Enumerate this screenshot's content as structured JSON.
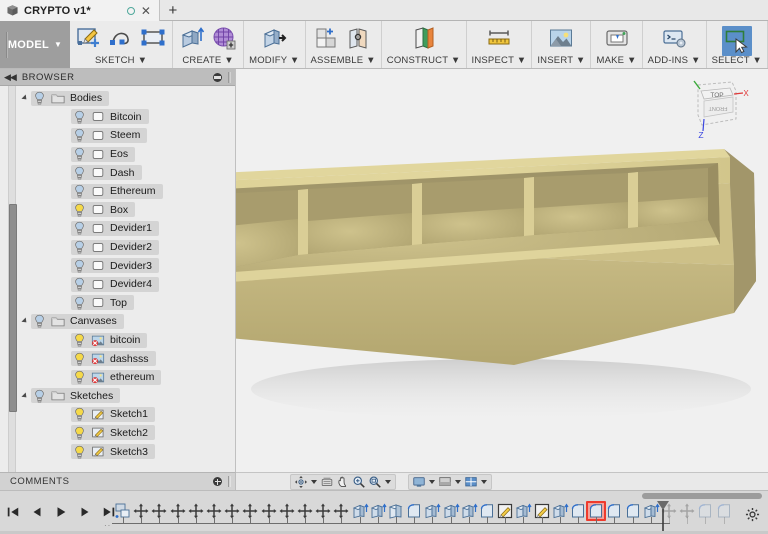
{
  "window": {
    "tab": {
      "title": "CRYPTO v1*",
      "doc_icon": "box-icon",
      "unsaved_dot": "unsaved-indicator",
      "close_label": "✕",
      "new_tab_label": "+"
    }
  },
  "ribbon": {
    "workspace": {
      "label": "MODEL",
      "caret": "▼"
    },
    "panels": [
      {
        "name": "sketch",
        "label": "SKETCH ▼",
        "icons": [
          "create-sketch-icon",
          "spline-icon",
          "rectangle-icon"
        ]
      },
      {
        "name": "create",
        "label": "CREATE ▼",
        "icons": [
          "extrude-icon",
          "form-icon"
        ]
      },
      {
        "name": "modify",
        "label": "MODIFY ▼",
        "icons": [
          "press-pull-icon"
        ]
      },
      {
        "name": "assemble",
        "label": "ASSEMBLE ▼",
        "icons": [
          "new-component-icon",
          "joint-icon"
        ]
      },
      {
        "name": "construct",
        "label": "CONSTRUCT ▼",
        "icons": [
          "offset-plane-icon"
        ]
      },
      {
        "name": "inspect",
        "label": "INSPECT ▼",
        "icons": [
          "measure-icon"
        ]
      },
      {
        "name": "insert",
        "label": "INSERT ▼",
        "icons": [
          "insert-canvas-icon"
        ]
      },
      {
        "name": "make",
        "label": "MAKE ▼",
        "icons": [
          "3d-print-icon"
        ]
      },
      {
        "name": "addins",
        "label": "ADD-INS ▼",
        "icons": [
          "scripts-addins-icon"
        ]
      },
      {
        "name": "select",
        "label": "SELECT ▼",
        "icons": [
          "select-cursor-icon"
        ],
        "active": true
      }
    ]
  },
  "browser": {
    "header": {
      "title": "BROWSER",
      "collapse_icon": "collapse-left-icon",
      "options_icon": "panel-options-icon"
    },
    "tree": [
      {
        "label": "Bodies",
        "depth": 1,
        "icon": "folder-icon",
        "expanded": true,
        "bulb": "on-blue"
      },
      {
        "label": "Bitcoin",
        "depth": 2,
        "icon": "body-icon",
        "expanded": false,
        "bulb": "on-blue"
      },
      {
        "label": "Steem",
        "depth": 2,
        "icon": "body-icon",
        "expanded": false,
        "bulb": "on-blue"
      },
      {
        "label": "Eos",
        "depth": 2,
        "icon": "body-icon",
        "expanded": false,
        "bulb": "on-blue"
      },
      {
        "label": "Dash",
        "depth": 2,
        "icon": "body-icon",
        "expanded": false,
        "bulb": "on-blue"
      },
      {
        "label": "Ethereum",
        "depth": 2,
        "icon": "body-icon",
        "expanded": false,
        "bulb": "on-blue"
      },
      {
        "label": "Box",
        "depth": 2,
        "icon": "body-icon",
        "expanded": false,
        "bulb": "on-yellow"
      },
      {
        "label": "Devider1",
        "depth": 2,
        "icon": "body-icon",
        "expanded": false,
        "bulb": "on-blue"
      },
      {
        "label": "Devider2",
        "depth": 2,
        "icon": "body-icon",
        "expanded": false,
        "bulb": "on-blue"
      },
      {
        "label": "Devider3",
        "depth": 2,
        "icon": "body-icon",
        "expanded": false,
        "bulb": "on-blue"
      },
      {
        "label": "Devider4",
        "depth": 2,
        "icon": "body-icon",
        "expanded": false,
        "bulb": "on-blue"
      },
      {
        "label": "Top",
        "depth": 2,
        "icon": "body-icon",
        "expanded": false,
        "bulb": "on-blue"
      },
      {
        "label": "Canvases",
        "depth": 1,
        "icon": "folder-icon",
        "expanded": true,
        "bulb": "on-blue"
      },
      {
        "label": "bitcoin",
        "depth": 2,
        "icon": "canvas-icon",
        "expanded": false,
        "bulb": "on-yellow"
      },
      {
        "label": "dashsss",
        "depth": 2,
        "icon": "canvas-icon",
        "expanded": false,
        "bulb": "on-yellow"
      },
      {
        "label": "ethereum",
        "depth": 2,
        "icon": "canvas-icon",
        "expanded": false,
        "bulb": "on-yellow"
      },
      {
        "label": "Sketches",
        "depth": 1,
        "icon": "folder-icon",
        "expanded": true,
        "bulb": "on-blue"
      },
      {
        "label": "Sketch1",
        "depth": 2,
        "icon": "sketch-icon",
        "expanded": false,
        "bulb": "on-yellow"
      },
      {
        "label": "Sketch2",
        "depth": 2,
        "icon": "sketch-icon",
        "expanded": false,
        "bulb": "on-yellow"
      },
      {
        "label": "Sketch3",
        "depth": 2,
        "icon": "sketch-icon",
        "expanded": false,
        "bulb": "on-yellow"
      }
    ]
  },
  "comments": {
    "title": "COMMENTS",
    "add_icon": "add-comment-icon"
  },
  "viewport": {
    "background_color": "#f0f0f0",
    "model": {
      "name": "divided-tray",
      "compartments": 5,
      "face_color": "#c3b681",
      "rim_color": "#d9cd8f",
      "inner_color": "#a79b6b",
      "shadow_color": "#d8d8d8"
    },
    "viewcube": {
      "top_face_label": "TOP",
      "front_face_label": "FRONT",
      "axis_x_label": "X",
      "axis_x_color": "#e03a3a",
      "axis_z_label": "Z",
      "axis_z_color": "#3a46e0",
      "axis_y_color": "#3aaa3a"
    }
  },
  "navbar": {
    "group1": [
      {
        "name": "orbit-icon",
        "has_caret": true
      },
      {
        "name": "look-at-icon",
        "has_caret": false
      },
      {
        "name": "pan-icon",
        "has_caret": false
      },
      {
        "name": "zoom-icon",
        "has_caret": false
      },
      {
        "name": "zoom-window-icon",
        "has_caret": true
      }
    ],
    "group2": [
      {
        "name": "display-settings-icon",
        "has_caret": true
      },
      {
        "name": "grid-snap-icon",
        "has_caret": true
      },
      {
        "name": "viewports-icon",
        "has_caret": true
      }
    ]
  },
  "timeline": {
    "playback": [
      {
        "name": "jump-to-beginning-icon",
        "glyph": "⏮"
      },
      {
        "name": "step-back-icon",
        "glyph": "◀"
      },
      {
        "name": "play-icon",
        "glyph": "▶"
      },
      {
        "name": "step-forward-icon",
        "glyph": "▶"
      },
      {
        "name": "jump-to-end-icon",
        "glyph": "⏭"
      }
    ],
    "features": [
      {
        "index": 0,
        "name": "canvas-feature-icon",
        "type": "canvas",
        "selected": false,
        "future": false
      },
      {
        "index": 1,
        "name": "sketch-point-icon",
        "type": "move",
        "selected": false,
        "future": false
      },
      {
        "index": 2,
        "name": "sketch-point-icon",
        "type": "move",
        "selected": false,
        "future": false
      },
      {
        "index": 3,
        "name": "sketch-point-icon",
        "type": "move",
        "selected": false,
        "future": false
      },
      {
        "index": 4,
        "name": "sketch-point-icon",
        "type": "move",
        "selected": false,
        "future": false
      },
      {
        "index": 5,
        "name": "sketch-point-icon",
        "type": "move",
        "selected": false,
        "future": false
      },
      {
        "index": 6,
        "name": "sketch-point-icon",
        "type": "move",
        "selected": false,
        "future": false
      },
      {
        "index": 7,
        "name": "sketch-point-icon",
        "type": "move",
        "selected": false,
        "future": false
      },
      {
        "index": 8,
        "name": "sketch-point-icon",
        "type": "move",
        "selected": false,
        "future": false
      },
      {
        "index": 9,
        "name": "sketch-point-icon",
        "type": "move",
        "selected": false,
        "future": false
      },
      {
        "index": 10,
        "name": "sketch-point-icon",
        "type": "move",
        "selected": false,
        "future": false
      },
      {
        "index": 11,
        "name": "sketch-point-icon",
        "type": "move",
        "selected": false,
        "future": false
      },
      {
        "index": 12,
        "name": "sketch-point-icon",
        "type": "move",
        "selected": false,
        "future": false
      },
      {
        "index": 13,
        "name": "extrude-feature-icon",
        "type": "extrude",
        "selected": false,
        "future": false
      },
      {
        "index": 14,
        "name": "extrude-feature-icon",
        "type": "extrude",
        "selected": false,
        "future": false
      },
      {
        "index": 15,
        "name": "shell-feature-icon",
        "type": "shell",
        "selected": false,
        "future": false
      },
      {
        "index": 16,
        "name": "fillet-feature-icon",
        "type": "fillet",
        "selected": false,
        "future": false
      },
      {
        "index": 17,
        "name": "extrude-feature-icon",
        "type": "extrude",
        "selected": false,
        "future": false
      },
      {
        "index": 18,
        "name": "extrude-feature-icon",
        "type": "extrude",
        "selected": false,
        "future": false
      },
      {
        "index": 19,
        "name": "extrude-feature-icon",
        "type": "extrude",
        "selected": false,
        "future": false
      },
      {
        "index": 20,
        "name": "fillet-feature-icon",
        "type": "fillet",
        "selected": false,
        "future": false
      },
      {
        "index": 21,
        "name": "sketch-feature-icon",
        "type": "sketch",
        "selected": false,
        "future": false
      },
      {
        "index": 22,
        "name": "extrude-feature-icon",
        "type": "extrude",
        "selected": false,
        "future": false
      },
      {
        "index": 23,
        "name": "sketch-feature-icon",
        "type": "sketch",
        "selected": false,
        "future": false
      },
      {
        "index": 24,
        "name": "extrude-feature-icon",
        "type": "extrude",
        "selected": false,
        "future": false
      },
      {
        "index": 25,
        "name": "fillet-feature-icon",
        "type": "fillet",
        "selected": false,
        "future": false
      },
      {
        "index": 26,
        "name": "fillet-feature-icon",
        "type": "fillet",
        "selected": true,
        "future": false
      },
      {
        "index": 27,
        "name": "fillet-feature-icon",
        "type": "fillet",
        "selected": false,
        "future": false
      },
      {
        "index": 28,
        "name": "fillet-feature-icon",
        "type": "fillet",
        "selected": false,
        "future": false
      },
      {
        "index": 29,
        "name": "extrude-feature-icon",
        "type": "extrude",
        "selected": false,
        "future": false
      },
      {
        "index": 30,
        "name": "sketch-point-icon",
        "type": "move",
        "selected": false,
        "future": true
      },
      {
        "index": 31,
        "name": "sketch-point-icon",
        "type": "move",
        "selected": false,
        "future": true
      },
      {
        "index": 32,
        "name": "fillet-feature-icon",
        "type": "fillet",
        "selected": false,
        "future": true
      },
      {
        "index": 33,
        "name": "fillet-feature-icon",
        "type": "fillet",
        "selected": false,
        "future": true
      }
    ],
    "marker": {
      "name": "timeline-playhead",
      "position_index": 29
    },
    "settings_icon": "timeline-settings-icon",
    "scrollbar": "timeline-horizontal-scrollbar"
  }
}
